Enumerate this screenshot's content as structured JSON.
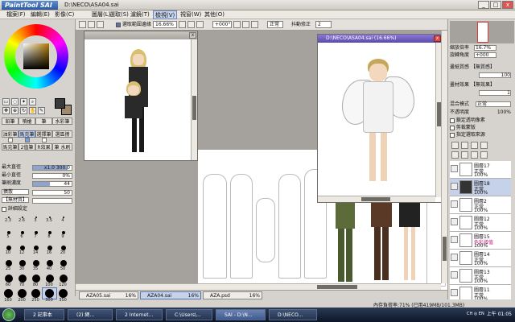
{
  "app": {
    "logo": "PaintTool SAI",
    "title": "D:\\NECO\\ASA04.sai"
  },
  "menu": [
    "檔案(F)",
    "編輯(E)",
    "影像(C)",
    "圖層(L)",
    "選取(S)",
    "濾鏡(T)",
    "檢視(V)",
    "視窗(W)",
    "其他(O)"
  ],
  "menu_active_index": 6,
  "toolbar": {
    "select_fade": "選取範圍邊緣",
    "zoom": "16.66%",
    "angle": "+000°",
    "mode": "正常",
    "stabilizer_label": "抖動修正",
    "stabilizer": "2"
  },
  "left": {
    "tools_row1": [
      "鉛筆",
      "噴槍",
      "筆",
      "水彩筆"
    ],
    "tools_row2": [
      "油彩筆",
      "馬克筆",
      "選擇筆",
      "選區擦"
    ],
    "tools_row3": [
      "馬克筆",
      "2值筆",
      "R效果",
      "筆 水刷"
    ],
    "params": [
      {
        "label": "最大直徑",
        "value": "x1.0  300.0",
        "fill": 0.9
      },
      {
        "label": "最小直徑",
        "value": "0%",
        "fill": 0.0
      },
      {
        "label": "筆刷濃度",
        "value": "44",
        "fill": 0.44
      }
    ],
    "brush_shape": "擴散",
    "brush_shape_value": "50",
    "texture": "【無材質】",
    "detail": "詳細設定",
    "size_labels": [
      "2.3",
      "2.6",
      "3",
      "3.5",
      "4",
      "5",
      "6",
      "7",
      "8",
      "9",
      "10",
      "12",
      "14",
      "16",
      "20",
      "25",
      "30",
      "35",
      "40",
      "50",
      "60",
      "70",
      "80",
      "100",
      "120",
      "160",
      "200",
      "250",
      "300",
      "350",
      "400",
      "450",
      "500"
    ]
  },
  "subwindows": [
    {
      "title": "",
      "zoom": ""
    },
    {
      "title": "D:\\NECO\\ASA04.sai (16.66%)",
      "close": "x"
    }
  ],
  "doc_tabs": [
    {
      "name": "AZA05.sai",
      "pct": "16%"
    },
    {
      "name": "AZA04.sai",
      "pct": "16%"
    },
    {
      "name": "AZA.psd",
      "pct": "16%"
    }
  ],
  "status": "內存負荷率:71% (已用419MB/101.3MB)",
  "right": {
    "zoom_label": "縮放倍率",
    "zoom": "16.7%",
    "rotate_label": "旋轉角度",
    "rotate": "+000",
    "paper_label": "畫紙質感",
    "paper": "【無質感】",
    "paper_strength": "100",
    "effect_label": "畫材效果",
    "effect": "【無效果】",
    "effect_strength": "1",
    "blend_label": "混合模式",
    "blend": "正常",
    "opacity_label": "不透明度",
    "opacity": "100%",
    "check1": "鎖定透明像素",
    "check2": "剪裁蒙版",
    "check3": "指定選取來源"
  },
  "layers": [
    {
      "name": "圖層17",
      "mode": "正常",
      "op": "100%",
      "selected": false,
      "pink": false
    },
    {
      "name": "圖層18",
      "mode": "正常",
      "op": "100%",
      "selected": true,
      "pink": false
    },
    {
      "name": "圖層2",
      "mode": "正常",
      "op": "100%",
      "selected": false,
      "pink": false
    },
    {
      "name": "圖層12",
      "mode": "正常",
      "op": "100%",
      "selected": false,
      "pink": false
    },
    {
      "name": "圖層15",
      "mode": "色彩增值",
      "op": "100%",
      "selected": false,
      "pink": true
    },
    {
      "name": "圖層14",
      "mode": "正常",
      "op": "100%",
      "selected": false,
      "pink": false
    },
    {
      "name": "圖層13",
      "mode": "正常",
      "op": "100%",
      "selected": false,
      "pink": false
    },
    {
      "name": "圖層11",
      "mode": "正常",
      "op": "100%",
      "selected": false,
      "pink": false
    }
  ],
  "taskbar": {
    "tasks": [
      "2 記事本",
      "(2) 網...",
      "2 Internet...",
      "C:\\Users\\...",
      "SAI - D:\\N...",
      "D:\\NECO..."
    ],
    "active_index": 4,
    "tray": "CH  ◎ EN",
    "clock": "上午 01:05"
  }
}
